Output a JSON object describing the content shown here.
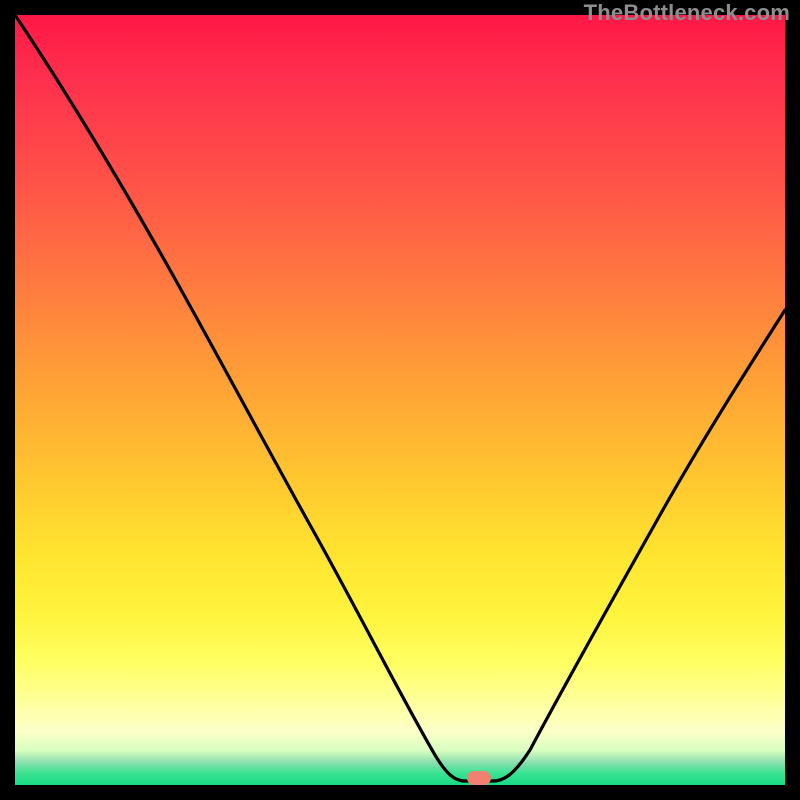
{
  "watermark": "TheBottleneck.com",
  "chart_data": {
    "type": "line",
    "title": "",
    "xlabel": "",
    "ylabel": "",
    "xlim": [
      0,
      100
    ],
    "ylim": [
      0,
      100
    ],
    "grid": false,
    "legend": false,
    "series": [
      {
        "name": "bottleneck-curve",
        "x": [
          0,
          6,
          12,
          18,
          24,
          30,
          36,
          42,
          48,
          52,
          55,
          58,
          60,
          62,
          65,
          70,
          76,
          82,
          88,
          94,
          100
        ],
        "y": [
          100,
          90,
          80,
          70,
          61,
          52,
          43,
          34,
          24,
          15,
          8,
          3,
          1,
          2,
          6,
          14,
          24,
          34,
          44,
          53,
          62
        ]
      }
    ],
    "background_gradient": {
      "stops": [
        {
          "pos": 0,
          "color": "#ff1846"
        },
        {
          "pos": 0.22,
          "color": "#ff5348"
        },
        {
          "pos": 0.48,
          "color": "#ffa236"
        },
        {
          "pos": 0.7,
          "color": "#ffe42f"
        },
        {
          "pos": 0.89,
          "color": "#ffff9a"
        },
        {
          "pos": 1.0,
          "color": "#18db85"
        }
      ]
    },
    "marker": {
      "x": 60,
      "y": 0,
      "color": "#f08070"
    }
  }
}
